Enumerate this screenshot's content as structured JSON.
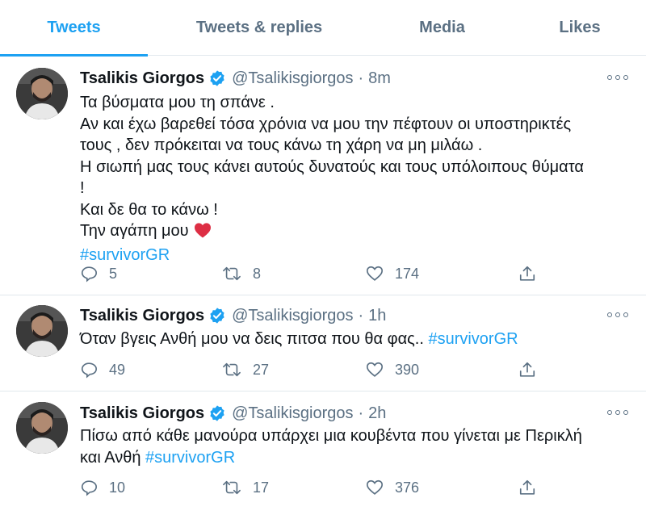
{
  "tabs": [
    {
      "label": "Tweets"
    },
    {
      "label": "Tweets & replies"
    },
    {
      "label": "Media"
    },
    {
      "label": "Likes"
    }
  ],
  "colors": {
    "accent": "#1da1f2",
    "muted": "#5b7083",
    "text": "#0f1419",
    "heart": "#e0245e"
  },
  "tweets": [
    {
      "name": "Tsalikis Giorgos",
      "handle": "@Tsalikisgiorgos",
      "dot": "·",
      "time": "8m",
      "lines": [
        "Τα βύσματα μου τη σπάνε .",
        "Αν και έχω βαρεθεί τόσα χρόνια να μου την πέφτουν οι υποστηρικτές",
        "τους , δεν πρόκειται να τους κάνω τη χάρη να μη μιλάω .",
        "Η σιωπή μας τους κάνει αυτούς  δυνατούς και τους υπόλοιπους θύματα",
        "!",
        "Και δε θα το κάνω !",
        "Την αγάπη μου"
      ],
      "hashtag": "#survivorGR",
      "replies": "5",
      "retweets": "8",
      "likes": "174"
    },
    {
      "name": "Tsalikis Giorgos",
      "handle": "@Tsalikisgiorgos",
      "dot": "·",
      "time": "1h",
      "text": "Όταν βγεις Ανθή μου να δεις πιτσα που θα φας..",
      "hashtag": "#survivorGR",
      "replies": "49",
      "retweets": "27",
      "likes": "390"
    },
    {
      "name": "Tsalikis Giorgos",
      "handle": "@Tsalikisgiorgos",
      "dot": "·",
      "time": "2h",
      "line1": "Πίσω από κάθε μανούρα υπάρχει  μια κουβέντα που γίνεται με Περικλή",
      "line2": "και Ανθή",
      "hashtag": "#survivorGR",
      "replies": "10",
      "retweets": "17",
      "likes": "376"
    }
  ]
}
